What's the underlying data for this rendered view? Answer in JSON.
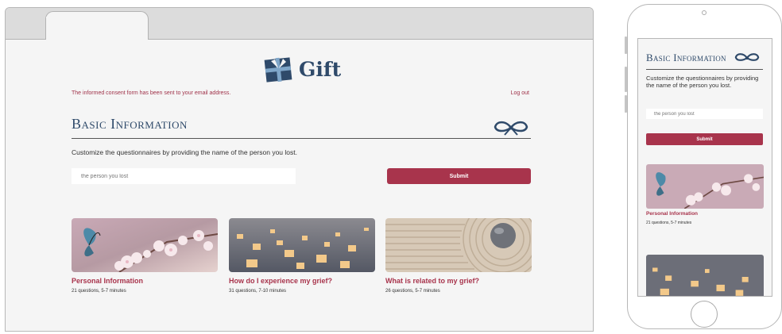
{
  "app": {
    "brand": "Gift",
    "consent_message": "The informed consent form has been sent to your email address.",
    "logout_label": "Log out"
  },
  "basic_info": {
    "title": "Basic Information",
    "intro": "Customize the questionnaires by providing the name of the person you lost.",
    "name_placeholder": "the person you lost",
    "submit_label": "Submit"
  },
  "cards": [
    {
      "title": "Personal Information",
      "meta": "21 questions, 5-7 minutes",
      "image": "butterfly-blossoms"
    },
    {
      "title": "How do I experience my grief?",
      "meta": "31 questions, 7-10 minutes",
      "image": "floating-lanterns"
    },
    {
      "title": "What is related to my grief?",
      "meta": "26 questions, 5-7 minutes",
      "image": "zen-garden-stone"
    }
  ],
  "colors": {
    "accent": "#a8344c",
    "navy": "#2f4a6a",
    "page_bg": "#f5f5f5"
  }
}
